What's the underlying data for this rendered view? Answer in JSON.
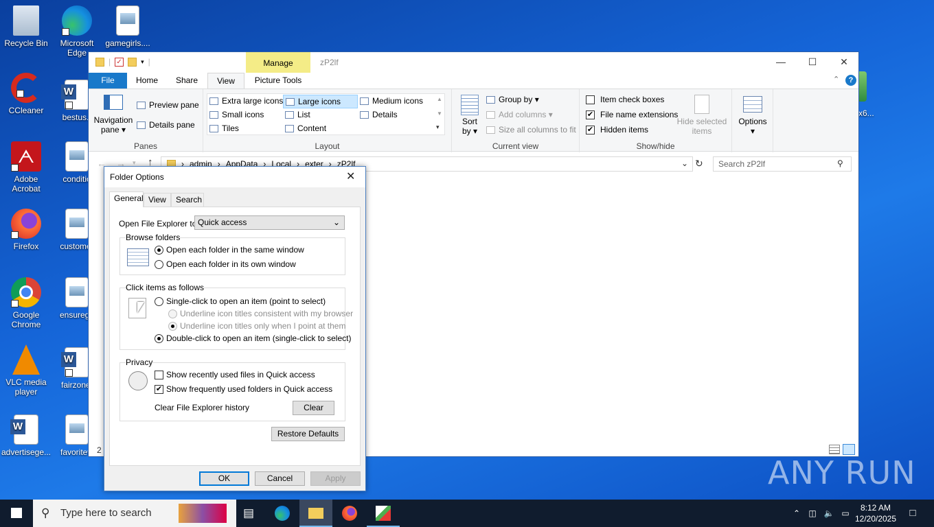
{
  "desktop": {
    "icons": [
      {
        "label": "Recycle Bin"
      },
      {
        "label": "Microsoft Edge"
      },
      {
        "label": "gamegirls...."
      },
      {
        "label": "CCleaner"
      },
      {
        "label": "bestus.r"
      },
      {
        "label": "Adobe Acrobat"
      },
      {
        "label": "conditio"
      },
      {
        "label": "Firefox"
      },
      {
        "label": "customer"
      },
      {
        "label": "Google Chrome"
      },
      {
        "label": "ensuregu"
      },
      {
        "label": "VLC media player"
      },
      {
        "label": "fairzone."
      },
      {
        "label": "advertisege..."
      },
      {
        "label": "favoritew"
      },
      {
        "label": "x6..."
      }
    ]
  },
  "explorer": {
    "title": "zP2lf",
    "manage_label": "Manage",
    "picture_tools_label": "Picture Tools",
    "tabs": {
      "file": "File",
      "home": "Home",
      "share": "Share",
      "view": "View"
    },
    "ribbon": {
      "panes": {
        "nav_pane_1": "Navigation",
        "nav_pane_2": "pane ▾",
        "preview": "Preview pane",
        "details": "Details pane",
        "group": "Panes"
      },
      "layout": {
        "extra_large": "Extra large icons",
        "large": "Large icons",
        "medium": "Medium icons",
        "small": "Small icons",
        "list": "List",
        "details": "Details",
        "tiles": "Tiles",
        "content": "Content",
        "group": "Layout"
      },
      "current_view": {
        "sort_1": "Sort",
        "sort_2": "by ▾",
        "group_by": "Group by ▾",
        "add_columns": "Add columns ▾",
        "size_all": "Size all columns to fit",
        "group": "Current view"
      },
      "show_hide": {
        "item_check": "Item check boxes",
        "file_ext": "File name extensions",
        "hidden": "Hidden items",
        "hide_selected_1": "Hide selected",
        "hide_selected_2": "items",
        "group": "Show/hide",
        "item_check_checked": false,
        "file_ext_checked": true,
        "hidden_checked": true
      },
      "options_1": "Options",
      "options_2": "▾"
    },
    "address": {
      "crumbs": [
        "admin",
        "AppData",
        "Local",
        "exter",
        "zP2lf"
      ],
      "separator": "›"
    },
    "search_placeholder": "Search zP2lf",
    "status_count": "2"
  },
  "dialog": {
    "title": "Folder Options",
    "tabs": {
      "general": "General",
      "view": "View",
      "search": "Search"
    },
    "open_to_label": "Open File Explorer to:",
    "open_to_value": "Quick access",
    "browse": {
      "legend": "Browse folders",
      "same": "Open each folder in the same window",
      "own": "Open each folder in its own window",
      "selected": "same"
    },
    "click": {
      "legend": "Click items as follows",
      "single": "Single-click to open an item (point to select)",
      "underline_browser": "Underline icon titles consistent with my browser",
      "underline_point": "Underline icon titles only when I point at them",
      "double": "Double-click to open an item (single-click to select)",
      "selected": "double"
    },
    "privacy": {
      "legend": "Privacy",
      "recent": "Show recently used files in Quick access",
      "frequent": "Show frequently used folders in Quick access",
      "clear_history": "Clear File Explorer history",
      "clear_btn": "Clear",
      "recent_checked": false,
      "frequent_checked": true
    },
    "restore_defaults": "Restore Defaults",
    "ok": "OK",
    "cancel": "Cancel",
    "apply": "Apply"
  },
  "taskbar": {
    "search_placeholder": "Type here to search",
    "time": "8:12 AM",
    "date": "12/20/2025"
  },
  "watermark": "ANY RUN"
}
